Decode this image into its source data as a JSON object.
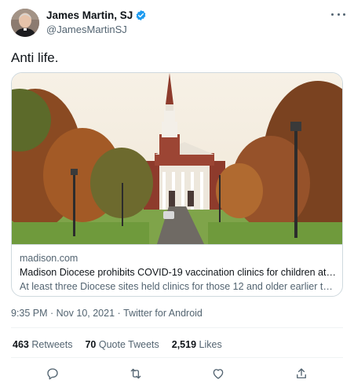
{
  "author": {
    "display_name": "James Martin, SJ",
    "handle": "@JamesMartinSJ",
    "verified": true,
    "verified_color": "#1d9bf0"
  },
  "tweet": {
    "text": "Anti life."
  },
  "link_card": {
    "domain": "madison.com",
    "title": "Madison Diocese prohibits COVID-19 vaccination clinics for children at its scho…",
    "description": "At least three Diocese sites held clinics for those 12 and older earlier this year."
  },
  "meta": {
    "time": "9:35 PM · Nov 10, 2021",
    "separator": " · ",
    "source": "Twitter for Android"
  },
  "stats": {
    "retweets_count": "463",
    "retweets_label": "Retweets",
    "quote_count": "70",
    "quote_label": "Quote Tweets",
    "likes_count": "2,519",
    "likes_label": "Likes"
  },
  "actions": [
    "reply-icon",
    "retweet-icon",
    "like-icon",
    "share-icon"
  ],
  "colors": {
    "text_primary": "#0f1419",
    "text_secondary": "#536471",
    "border": "#cfd9de"
  }
}
